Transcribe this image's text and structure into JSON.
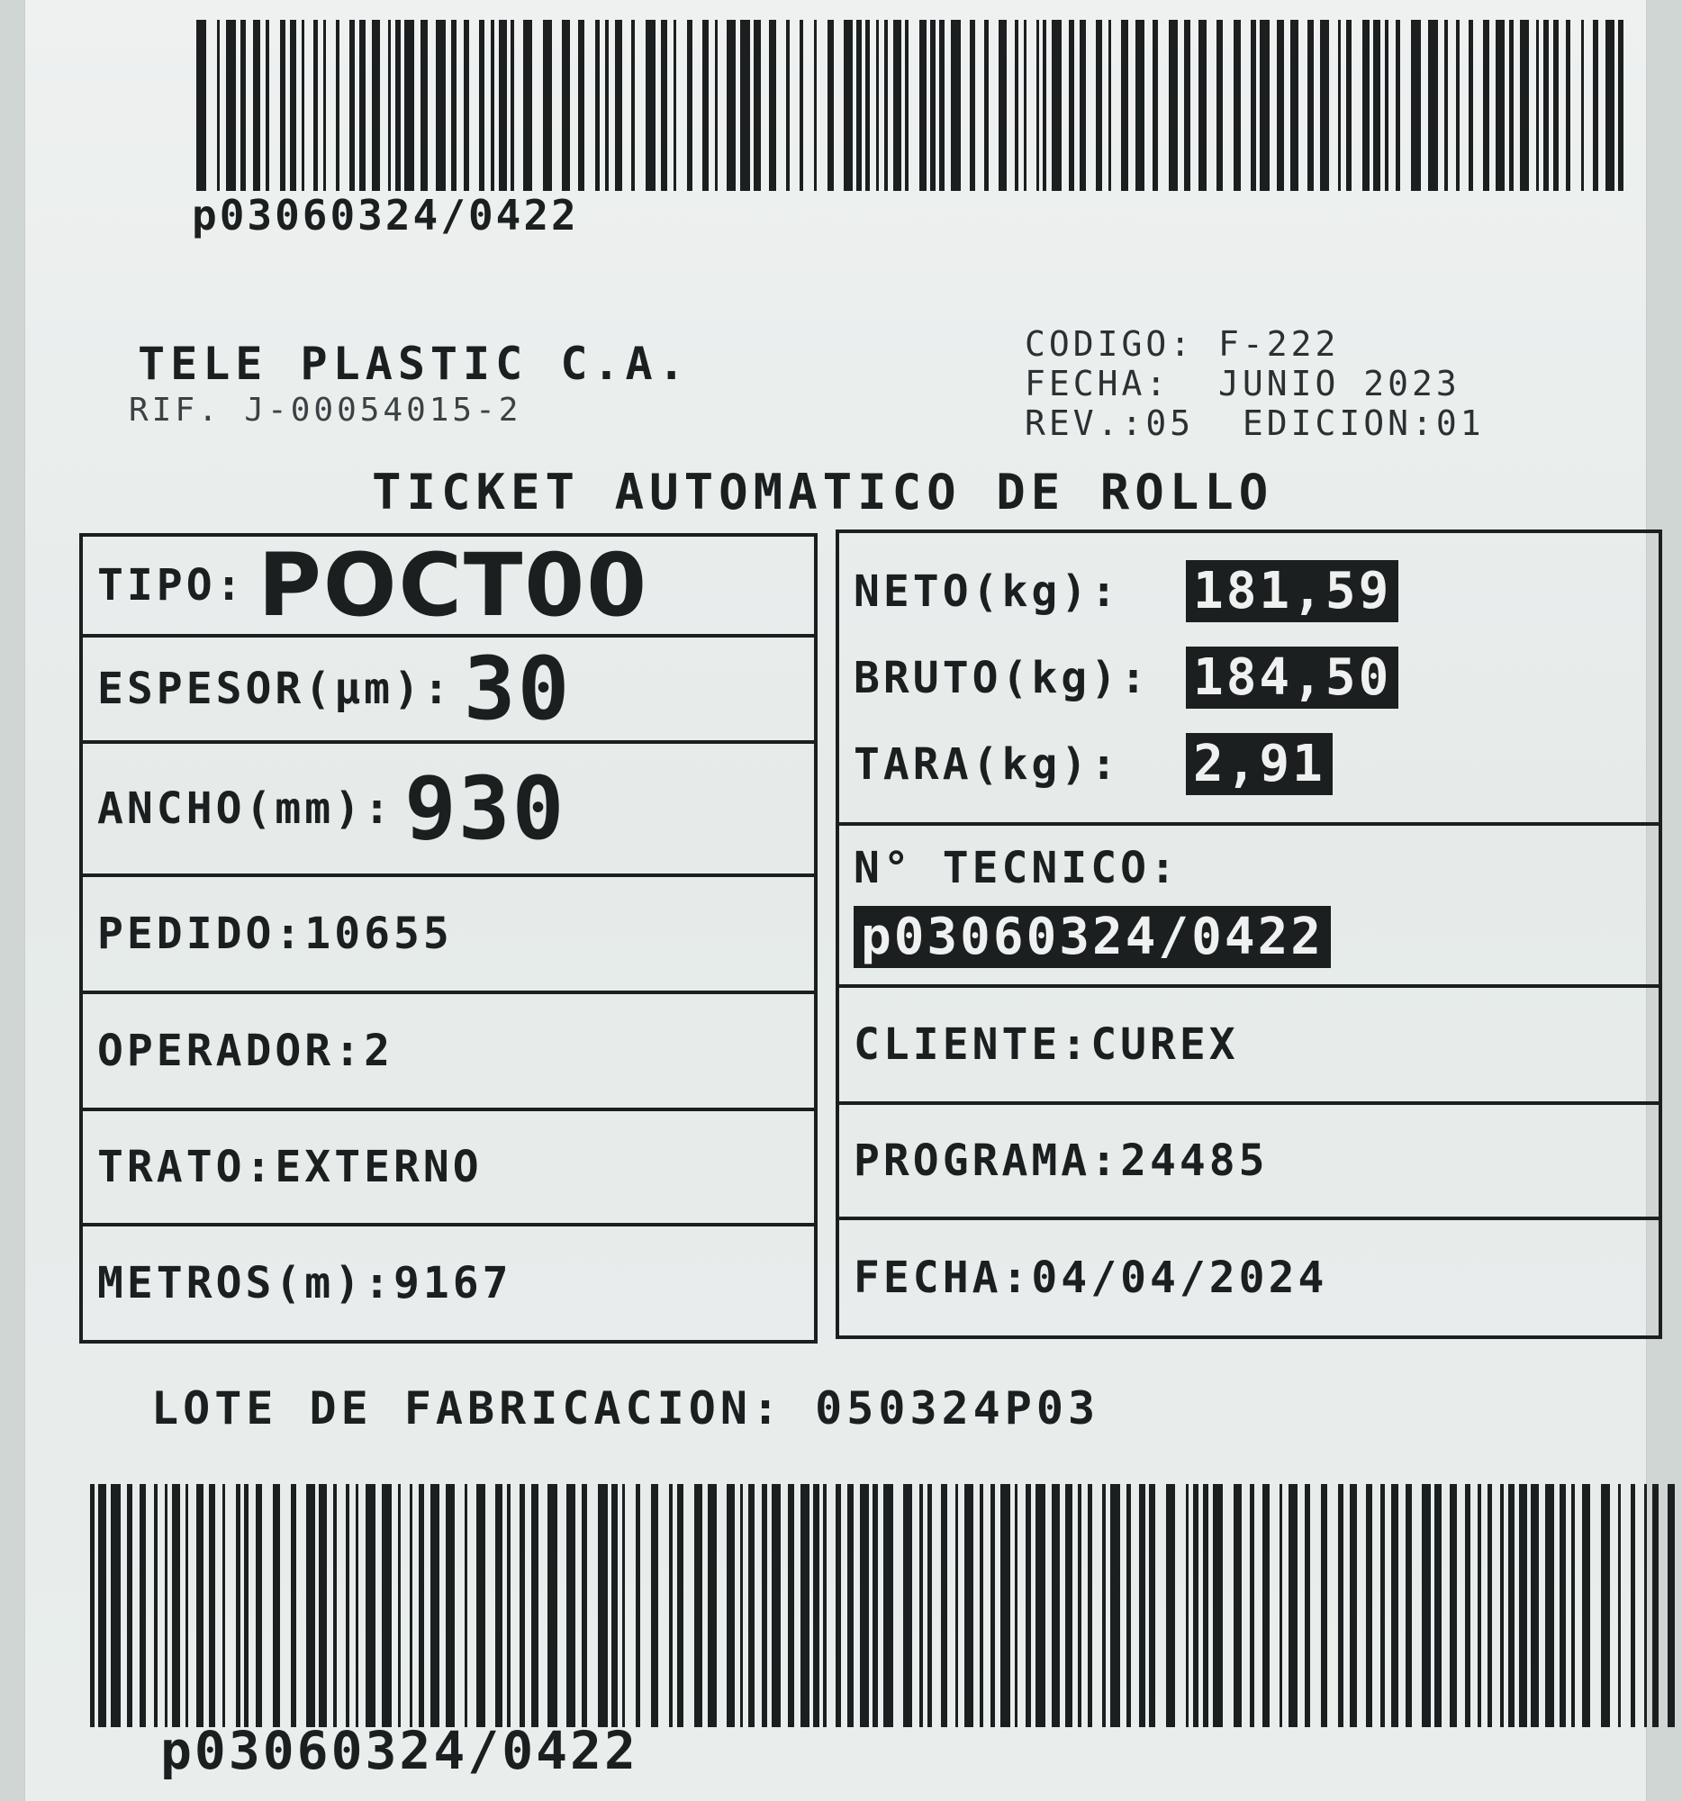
{
  "barcodes": {
    "top_text": "p03060324/0422",
    "bottom_text": "p03060324/0422"
  },
  "company": {
    "name": "TELE PLASTIC C.A.",
    "rif": "RIF. J-00054015-2"
  },
  "document": {
    "codigo": "CODIGO: F-222",
    "fecha": "FECHA:  JUNIO 2023",
    "revision": "REV.:05  EDICION:01"
  },
  "title": "TICKET AUTOMATICO DE ROLLO",
  "left_fields": {
    "tipo_label": "TIPO:",
    "tipo_value": "POCT00",
    "espesor_label": "ESPESOR(µm):",
    "espesor_value": "30",
    "ancho_label": "ANCHO(mm):",
    "ancho_value": "930",
    "pedido": "PEDIDO:10655",
    "operador": "OPERADOR:2",
    "trato": "TRATO:EXTERNO",
    "metros": "METROS(m):9167"
  },
  "right_fields": {
    "neto_label": "NETO(kg):",
    "neto_value": "181,59",
    "bruto_label": "BRUTO(kg):",
    "bruto_value": "184,50",
    "tara_label": "TARA(kg):",
    "tara_value": "2,91",
    "tecnico_label": "N° TECNICO:",
    "tecnico_value": "p03060324/0422",
    "cliente": "CLIENTE:CUREX",
    "programa": "PROGRAMA:24485",
    "fecha": "FECHA:04/04/2024"
  },
  "lote": "LOTE DE FABRICACION: 050324P03"
}
